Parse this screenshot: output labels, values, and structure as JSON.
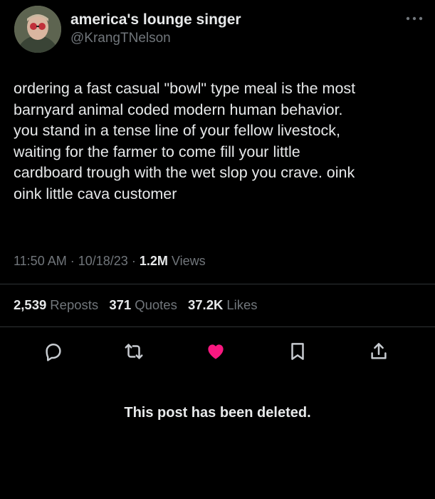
{
  "author": {
    "display_name": "america's lounge singer",
    "handle": "@KrangTNelson"
  },
  "tweet": {
    "text": "ordering a fast casual \"bowl\" type meal is the most\nbarnyard animal coded modern human behavior.\nyou stand in a tense line of your fellow livestock,\nwaiting for the farmer to come fill your little\ncardboard trough with the wet slop you crave. oink\noink little cava customer"
  },
  "meta": {
    "time": "11:50 AM",
    "separator": "·",
    "date": "10/18/23",
    "views_count": "1.2M",
    "views_label": "Views"
  },
  "stats": {
    "reposts_count": "2,539",
    "reposts_label": "Reposts",
    "quotes_count": "371",
    "quotes_label": "Quotes",
    "likes_count": "37.2K",
    "likes_label": "Likes"
  },
  "actions": {
    "reply_icon": "reply-icon",
    "repost_icon": "repost-icon",
    "like_icon": "heart-icon",
    "like_color": "#f91880",
    "bookmark_icon": "bookmark-icon",
    "share_icon": "share-icon"
  },
  "notice": "This post has been deleted."
}
